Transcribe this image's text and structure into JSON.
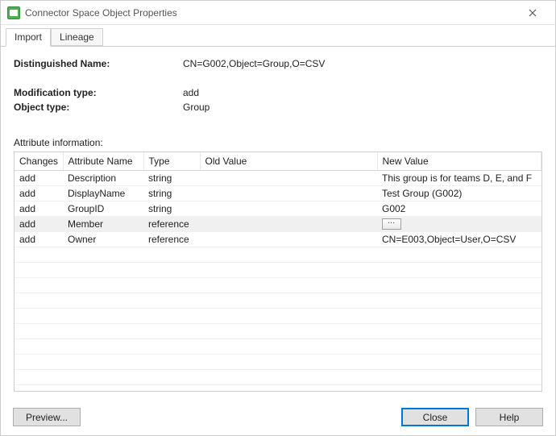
{
  "window": {
    "title": "Connector Space Object Properties"
  },
  "tabs": [
    {
      "label": "Import",
      "active": true
    },
    {
      "label": "Lineage",
      "active": false
    }
  ],
  "fields": {
    "dn_label": "Distinguished Name:",
    "dn_value": "CN=G002,Object=Group,O=CSV",
    "mod_label": "Modification type:",
    "mod_value": "add",
    "objtype_label": "Object type:",
    "objtype_value": "Group",
    "attrinfo_label": "Attribute information:"
  },
  "table": {
    "headers": {
      "changes": "Changes",
      "attribute_name": "Attribute Name",
      "type": "Type",
      "old_value": "Old Value",
      "new_value": "New Value"
    },
    "rows": [
      {
        "changes": "add",
        "attribute_name": "Description",
        "type": "string",
        "old_value": "",
        "new_value": "This group is for teams D, E, and F",
        "highlight": false,
        "button": false
      },
      {
        "changes": "add",
        "attribute_name": "DisplayName",
        "type": "string",
        "old_value": "",
        "new_value": "Test Group (G002)",
        "highlight": false,
        "button": false
      },
      {
        "changes": "add",
        "attribute_name": "GroupID",
        "type": "string",
        "old_value": "",
        "new_value": "G002",
        "highlight": false,
        "button": false
      },
      {
        "changes": "add",
        "attribute_name": "Member",
        "type": "reference",
        "old_value": "",
        "new_value": "",
        "highlight": true,
        "button": true
      },
      {
        "changes": "add",
        "attribute_name": "Owner",
        "type": "reference",
        "old_value": "",
        "new_value": "CN=E003,Object=User,O=CSV",
        "highlight": false,
        "button": false
      }
    ],
    "empty_rows": 9
  },
  "buttons": {
    "preview": "Preview...",
    "close": "Close",
    "help": "Help"
  }
}
